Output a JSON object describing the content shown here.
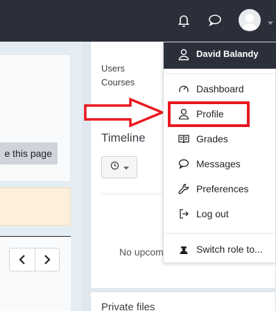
{
  "navbar": {
    "notification_icon": "bell-icon",
    "message_icon": "speech-bubble-icon",
    "avatar_icon": "user-avatar-icon"
  },
  "left": {
    "edit_button_label": "e this page",
    "pager_prev_icon": "chevron-left-icon",
    "pager_next_icon": "chevron-right-icon"
  },
  "right_panel": {
    "stats": [
      "Users",
      "Courses"
    ],
    "timeline_heading": "Timeline",
    "timeline_filter_icon": "clock-icon",
    "no_upcoming": "No upcoming activities due",
    "private_files": "Private files"
  },
  "user_menu": {
    "username": "David Balandy",
    "items": [
      {
        "label": "Dashboard",
        "icon": "gauge-icon"
      },
      {
        "label": "Profile",
        "icon": "user-icon"
      },
      {
        "label": "Grades",
        "icon": "grades-book-icon"
      },
      {
        "label": "Messages",
        "icon": "speech-bubble-icon"
      },
      {
        "label": "Preferences",
        "icon": "wrench-icon"
      },
      {
        "label": "Log out",
        "icon": "logout-icon"
      },
      {
        "label": "Switch role to...",
        "icon": "user-secret-icon"
      }
    ]
  },
  "annotation": {
    "highlight_color": "#e8181f",
    "highlighted_item": "Profile"
  }
}
